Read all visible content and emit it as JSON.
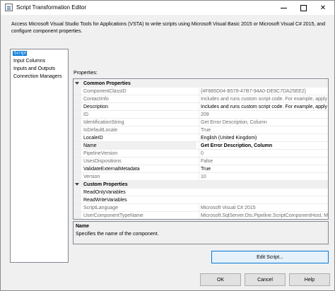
{
  "window": {
    "title": "Script Transformation Editor"
  },
  "description": "Access Microsoft Visual Studio Tools for Applications (VSTA) to write scripts using Microsoft Visual Basic 2015 or Microsoft Visual C# 2015, and configure component properties.",
  "nav": {
    "items": [
      {
        "label": "Script",
        "selected": true
      },
      {
        "label": "Input Columns",
        "selected": false
      },
      {
        "label": "Inputs and Outputs",
        "selected": false
      },
      {
        "label": "Connection Managers",
        "selected": false
      }
    ]
  },
  "properties_label": "Properties:",
  "grid": {
    "common_category": "Common Properties",
    "common": [
      {
        "name": "ComponentClassID",
        "value": "{4F885D04-B578-47B7-94A0-DE9C7DA25EE2}"
      },
      {
        "name": "ContactInfo",
        "value": "Includes and runs custom script code. For example, apply a b"
      },
      {
        "name": "Description",
        "value": "Includes and runs custom script code. For example, apply a b"
      },
      {
        "name": "ID",
        "value": "209"
      },
      {
        "name": "IdentificationString",
        "value": "Get Error Description, Column"
      },
      {
        "name": "IsDefaultLocale",
        "value": "True"
      },
      {
        "name": "LocaleID",
        "value": "English (United Kingdom)"
      },
      {
        "name": "Name",
        "value": "Get Error Description, Column"
      },
      {
        "name": "PipelineVersion",
        "value": "0"
      },
      {
        "name": "UsesDispositions",
        "value": "False"
      },
      {
        "name": "ValidateExternalMetadata",
        "value": "True"
      },
      {
        "name": "Version",
        "value": "10"
      }
    ],
    "custom_category": "Custom Properties",
    "custom": [
      {
        "name": "ReadOnlyVariables",
        "value": ""
      },
      {
        "name": "ReadWriteVariables",
        "value": ""
      },
      {
        "name": "ScriptLanguage",
        "value": "Microsoft Visual C# 2015"
      },
      {
        "name": "UserComponentTypeName",
        "value": "Microsoft.SqlServer.Dts.Pipeline.ScriptComponentHost, Micro"
      }
    ]
  },
  "help": {
    "title": "Name",
    "description": "Specifies the name of the component."
  },
  "buttons": {
    "edit_script": "Edit Script...",
    "ok": "OK",
    "cancel": "Cancel",
    "help": "Help"
  },
  "colors": {
    "selection": "#0078d7",
    "readonly_text": "#6d6d6d"
  }
}
